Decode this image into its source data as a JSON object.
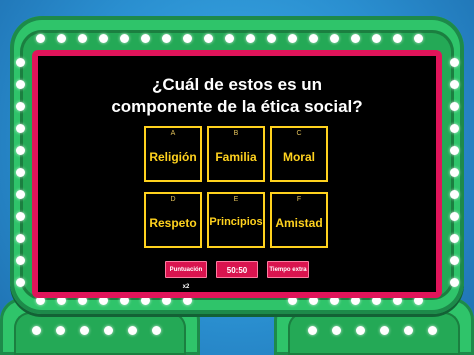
{
  "question": {
    "line1": "¿Cuál de estos es un",
    "line2": "componente de la ética social?"
  },
  "answers": [
    {
      "letter": "A",
      "text": "Religión"
    },
    {
      "letter": "B",
      "text": "Familia"
    },
    {
      "letter": "C",
      "text": "Moral"
    },
    {
      "letter": "D",
      "text": "Respeto"
    },
    {
      "letter": "E",
      "text": "Principios"
    },
    {
      "letter": "F",
      "text": "Amistad"
    }
  ],
  "controls": {
    "double_score_label": "Puntuación x2",
    "timer": "50:50",
    "extra_time_label": "Tiempo extra"
  },
  "colors": {
    "frame": "#2fc46a",
    "screen_border": "#e0145a",
    "answer_text": "#ffd21e",
    "button": "#d9144f",
    "background": "#2a8fd0"
  }
}
